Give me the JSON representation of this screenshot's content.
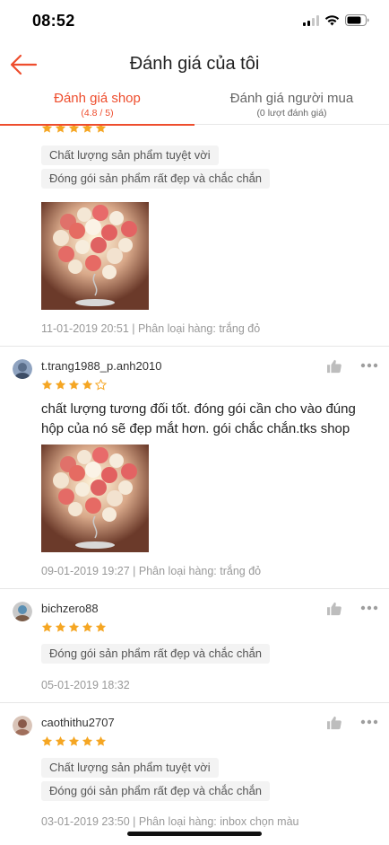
{
  "status": {
    "time": "08:52"
  },
  "nav": {
    "title": "Đánh giá của tôi"
  },
  "tabs": [
    {
      "label": "Đánh giá shop",
      "sub": "(4.8 / 5)"
    },
    {
      "label": "Đánh giá người mua",
      "sub": "(0 lượt đánh giá)"
    }
  ],
  "colors": {
    "accent": "#ee4d2d",
    "star": "#f5a623",
    "tag_bg": "#f3f3f3"
  },
  "reviews": [
    {
      "rating": 5,
      "tags": [
        "Chất lượng sản phẩm tuyệt vời",
        "Đóng gói sản phẩm rất đẹp và chắc chắn"
      ],
      "photo": "rose-lamp-photo",
      "date": "11-01-2019 20:51",
      "variation": " | Phân loại hàng: trắng đỏ"
    },
    {
      "username": "t.trang1988_p.anh2010",
      "rating": 4,
      "text": "chất lượng tương đối tốt. đóng gói cần cho vào đúng hộp của nó sẽ đẹp mắt hơn. gói chắc chắn.tks shop",
      "photo": "rose-lamp-photo",
      "date": "09-01-2019 19:27",
      "variation": " | Phân loại hàng: trắng đỏ"
    },
    {
      "username": "bichzero88",
      "rating": 5,
      "tags": [
        "Đóng gói sản phẩm rất đẹp và chắc chắn"
      ],
      "date": "05-01-2019 18:32"
    },
    {
      "username": "caothithu2707",
      "rating": 5,
      "tags": [
        "Chất lượng sản phẩm tuyệt vời",
        "Đóng gói sản phẩm rất đẹp và chắc chắn"
      ],
      "date": "03-01-2019 23:50",
      "variation": " | Phân loại hàng: inbox chọn màu"
    }
  ],
  "icons": {
    "back": "back-arrow-icon",
    "like": "thumbs-up-icon",
    "more": "more-dots-icon",
    "star": "star-icon"
  }
}
